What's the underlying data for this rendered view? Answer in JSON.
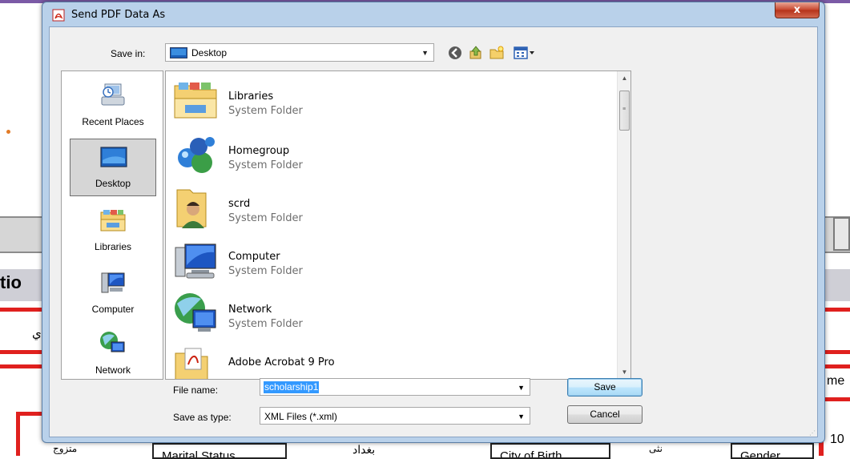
{
  "background": {
    "partial_heading": "tio",
    "arabic_fragment_1": "ي",
    "arabic_fragment_2": "متزوج",
    "arabic_fragment_3": "بغداد",
    "arabic_fragment_4": "نثى",
    "right_fragment_1": "me",
    "right_fragment_2": "10",
    "field_marital_status": "Marital Status",
    "field_city_of_birth": "City of Birth",
    "field_gender": "Gender"
  },
  "dialog": {
    "title": "Send PDF Data As",
    "close_label": "x",
    "save_in_label": "Save in:",
    "save_in_value": "Desktop"
  },
  "places": [
    {
      "label": "Recent Places",
      "icon": "recent-places-icon"
    },
    {
      "label": "Desktop",
      "icon": "desktop-icon",
      "selected": true
    },
    {
      "label": "Libraries",
      "icon": "libraries-icon"
    },
    {
      "label": "Computer",
      "icon": "computer-icon"
    },
    {
      "label": "Network",
      "icon": "network-icon"
    }
  ],
  "files": [
    {
      "name": "Libraries",
      "type": "System Folder",
      "icon": "libraries-folder-icon"
    },
    {
      "name": "Homegroup",
      "type": "System Folder",
      "icon": "homegroup-icon"
    },
    {
      "name": "scrd",
      "type": "System Folder",
      "icon": "user-folder-icon"
    },
    {
      "name": "Computer",
      "type": "System Folder",
      "icon": "computer-icon"
    },
    {
      "name": "Network",
      "type": "System Folder",
      "icon": "network-icon"
    },
    {
      "name": "Adobe Acrobat 9 Pro",
      "type": "",
      "icon": "acrobat-folder-icon"
    }
  ],
  "form": {
    "file_name_label": "File name:",
    "file_name_value": "scholarship1",
    "save_as_type_label": "Save as type:",
    "save_as_type_value": "XML Files (*.xml)",
    "save_button": "Save",
    "cancel_button": "Cancel"
  },
  "colors": {
    "selection": "#3399ff",
    "frame": "#b9d1ea",
    "close_button": "#c7452c",
    "background_red": "#e0201e"
  }
}
